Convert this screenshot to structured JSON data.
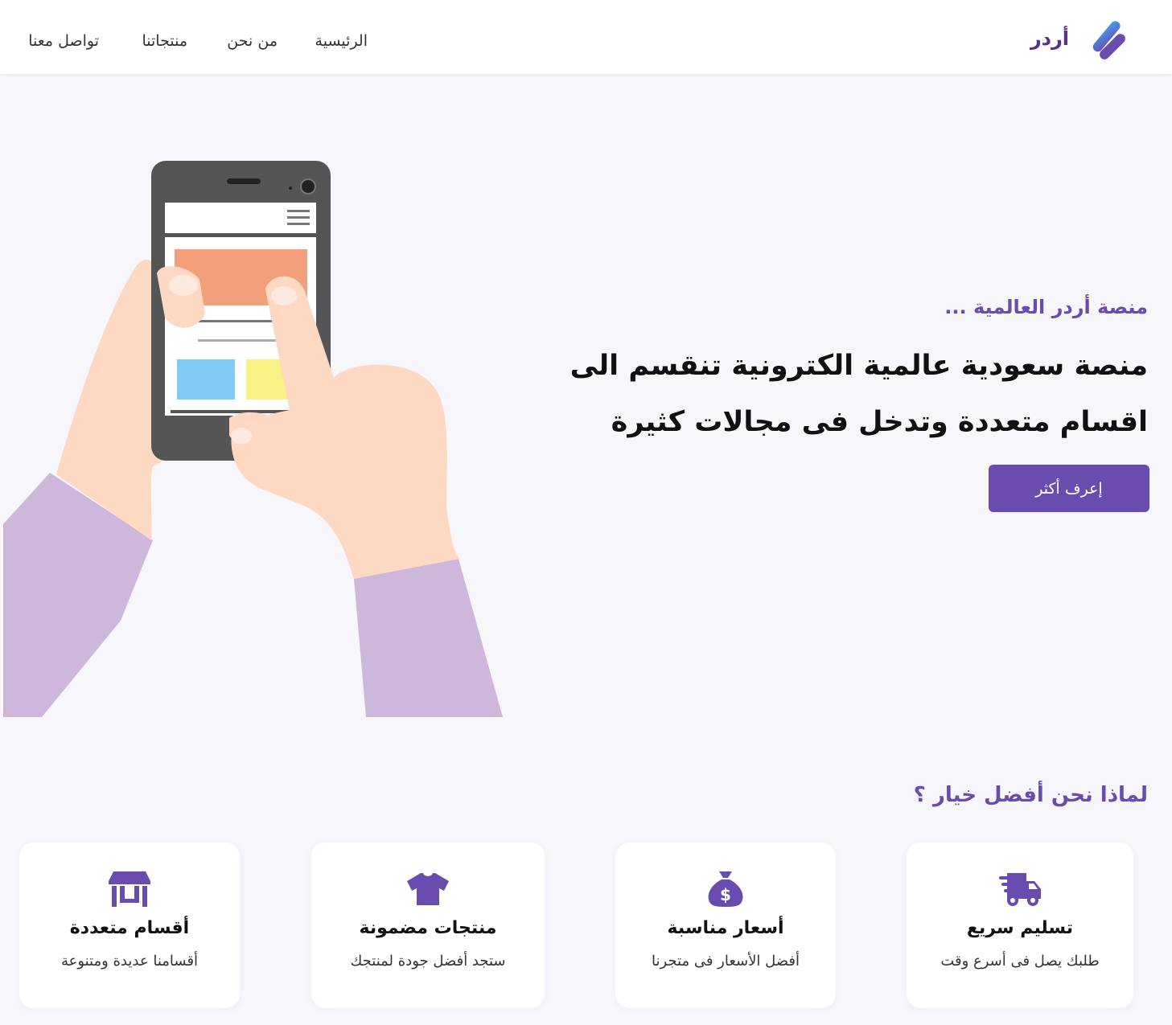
{
  "header": {
    "brand": "أردر",
    "nav": [
      {
        "label": "الرئيسية"
      },
      {
        "label": "من نحن"
      },
      {
        "label": "منتجاتنا"
      },
      {
        "label": "تواصل معنا"
      }
    ]
  },
  "hero": {
    "subtitle": "منصة أردر العالمية ...",
    "title": "منصة سعودية عالمية الكترونية تنقسم الى اقسام متعددة وتدخل فى مجالات كثيرة",
    "button": "إعرف أكثر"
  },
  "why": {
    "title": "لماذا نحن أفضل خيار ؟",
    "cards": [
      {
        "icon": "truck-icon",
        "title": "تسليم سريع",
        "desc": "طلبك يصل فى أسرع وقت"
      },
      {
        "icon": "money-bag-icon",
        "title": "أسعار مناسبة",
        "desc": "أفضل الأسعار فى متجرنا"
      },
      {
        "icon": "tshirt-icon",
        "title": "منتجات مضمونة",
        "desc": "ستجد أفضل جودة لمنتجك"
      },
      {
        "icon": "store-icon",
        "title": "أقسام متعددة",
        "desc": "أقسامنا عديدة ومتنوعة"
      }
    ]
  },
  "colors": {
    "accent": "#6a4caf",
    "brand": "#5b2e8e",
    "background": "#f7f6fb"
  }
}
